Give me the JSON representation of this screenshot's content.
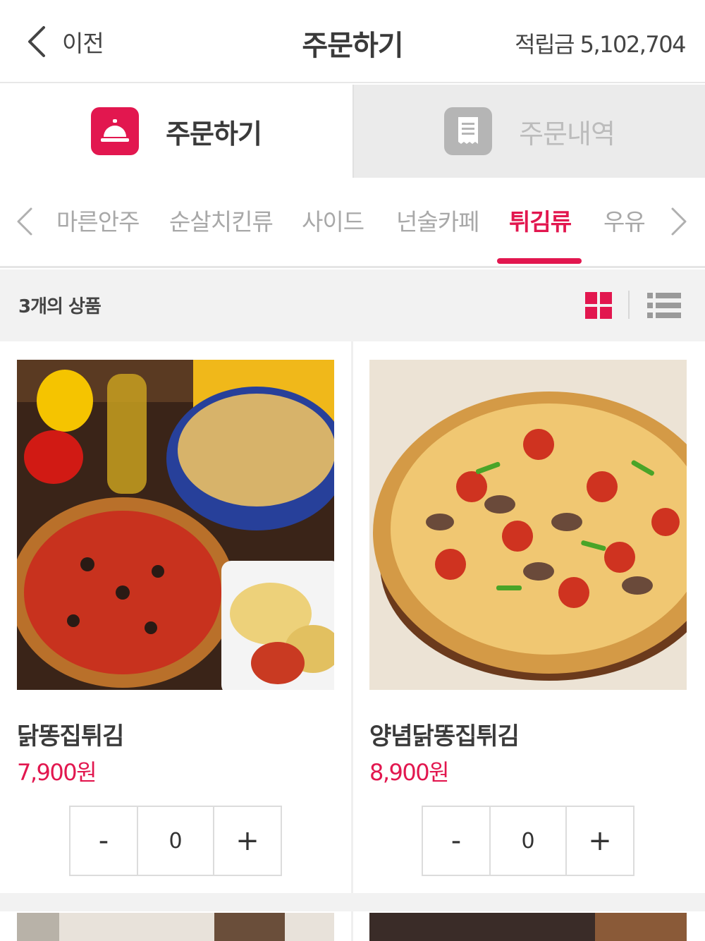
{
  "header": {
    "back_label": "이전",
    "title": "주문하기",
    "points": "적립금 5,102,704"
  },
  "main_tabs": [
    {
      "label": "주문하기",
      "icon": "service-bell-icon",
      "active": true
    },
    {
      "label": "주문내역",
      "icon": "receipt-icon",
      "active": false
    }
  ],
  "categories": {
    "items": [
      "마른안주",
      "순살치킨류",
      "사이드",
      "넌술카페",
      "튀김류",
      "우유"
    ],
    "active": "튀김류"
  },
  "count_text": "3개의 상품",
  "products": [
    {
      "name": "닭똥집튀김",
      "price": "7,900원",
      "quantity": "0",
      "minus": "-",
      "plus": "+"
    },
    {
      "name": "양념닭똥집튀김",
      "price": "8,900원",
      "quantity": "0",
      "minus": "-",
      "plus": "+"
    }
  ],
  "colors": {
    "accent": "#e2174f",
    "inactive_tab_bg": "#ebebeb",
    "count_bar_bg": "#f2f2f2"
  }
}
